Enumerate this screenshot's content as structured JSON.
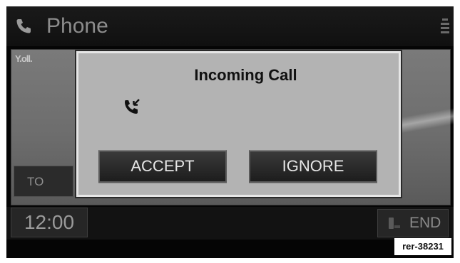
{
  "header": {
    "title": "Phone",
    "icon": "phone-icon",
    "menu_icon": "menu-icon"
  },
  "status": {
    "signal_text": "Y.oll."
  },
  "background": {
    "to_button_label": "TO"
  },
  "dialog": {
    "title": "Incoming Call",
    "icon": "incoming-call-icon",
    "accept_label": "ACCEPT",
    "ignore_label": "IGNORE"
  },
  "footer": {
    "clock": "12:00",
    "end_label": "END",
    "end_icon": "end-call-icon"
  },
  "reference_tag": "rer-38231"
}
